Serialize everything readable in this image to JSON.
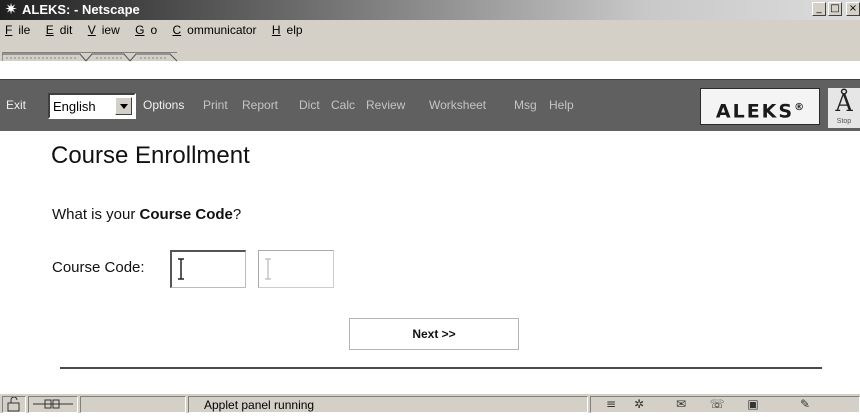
{
  "window": {
    "title": "ALEKS: - Netscape",
    "controls": {
      "minimize": "_",
      "maximize": "□",
      "close": "×"
    }
  },
  "menubar": {
    "items": [
      {
        "accel": "F",
        "rest": "ile"
      },
      {
        "accel": "E",
        "rest": "dit"
      },
      {
        "accel": "V",
        "rest": "iew"
      },
      {
        "accel": "G",
        "rest": "o"
      },
      {
        "accel": "C",
        "rest": "ommunicator"
      },
      {
        "accel": "H",
        "rest": "elp"
      }
    ]
  },
  "toolbar": {
    "exit": "Exit",
    "language": {
      "selected": "English"
    },
    "links": [
      "Options",
      "Print",
      "Report",
      "Dict",
      "Calc",
      "Review",
      "Worksheet",
      "Msg",
      "Help"
    ],
    "logo": {
      "text": "ALEKS",
      "mark": "®"
    },
    "stop": {
      "glyph": "Å",
      "label": "Stop"
    }
  },
  "content": {
    "title": "Course Enrollment",
    "question": {
      "prefix": "What is your ",
      "bold": "Course Code",
      "suffix": "?"
    },
    "code_label": "Course Code:",
    "code_field_1": "",
    "code_field_2": "",
    "next_button": "Next >>"
  },
  "statusbar": {
    "text": "Applet panel running",
    "icons": [
      "security-icon",
      "connection-icon",
      "document-icon",
      "navigator-icon",
      "mail-icon",
      "discussions-icon",
      "composer-icon",
      "edit-icon"
    ]
  },
  "colors": {
    "toolbar_bg": "#606060",
    "link_dim": "#c4c4c4",
    "link_bright": "#f0f0f0",
    "chrome": "#d4d0c8"
  }
}
